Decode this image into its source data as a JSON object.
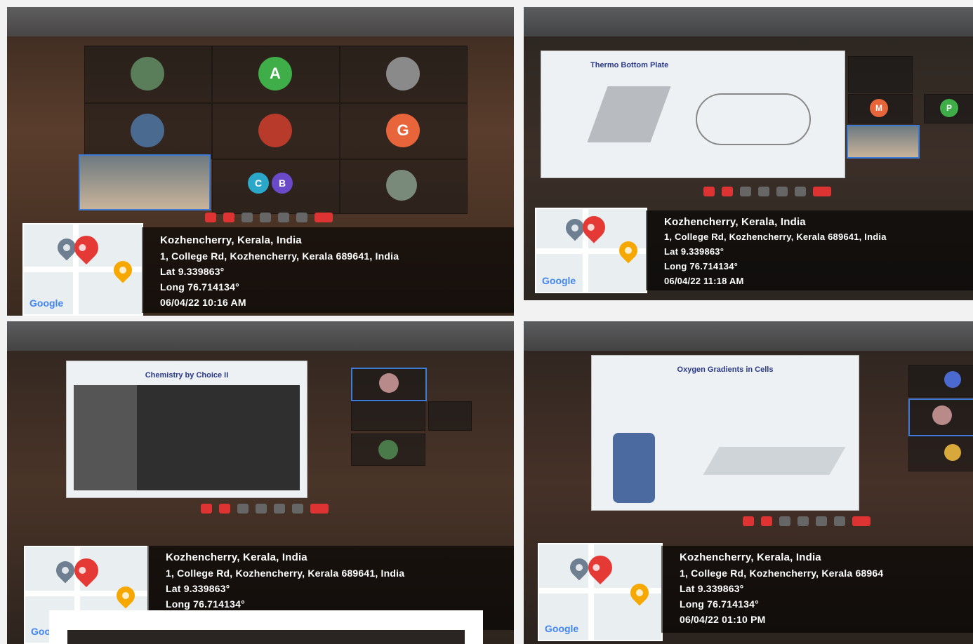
{
  "geotags": [
    {
      "city": "Kozhencherry, Kerala, India",
      "address": "1, College Rd, Kozhencherry, Kerala 689641, India",
      "lat": "Lat 9.339863°",
      "long": "Long 76.714134°",
      "datetime": "06/04/22 10:16 AM",
      "map_brand": "Google"
    },
    {
      "city": "Kozhencherry, Kerala, India",
      "address": "1, College Rd, Kozhencherry, Kerala 689641, India",
      "lat": "Lat 9.339863°",
      "long": "Long 76.714134°",
      "datetime": "06/04/22 11:18 AM",
      "map_brand": "Google"
    },
    {
      "city": "Kozhencherry, Kerala, India",
      "address": "1, College Rd, Kozhencherry, Kerala 689641, India",
      "lat": "Lat 9.339863°",
      "long": "Long 76.714134°",
      "datetime": "",
      "map_brand": "Google"
    },
    {
      "city": "Kozhencherry, Kerala, India",
      "address": "1, College Rd, Kozhencherry, Kerala 68964",
      "lat": "Lat 9.339863°",
      "long": "Long 76.714134°",
      "datetime": "06/04/22 01:10 PM",
      "map_brand": "Google"
    }
  ],
  "avatars": {
    "a": "A",
    "g": "G",
    "c": "C",
    "b": "B",
    "m": "M",
    "p": "P"
  },
  "slides": {
    "p2_title": "Thermo Bottom Plate",
    "p3_title": "Chemistry by Choice II",
    "p4_title": "Oxygen Gradients in Cells"
  },
  "colors": {
    "pin_red": "#e53935",
    "pin_gray": "#6d7f91",
    "pin_yellow": "#f6a800",
    "accent_blue": "#3d7bd6"
  }
}
